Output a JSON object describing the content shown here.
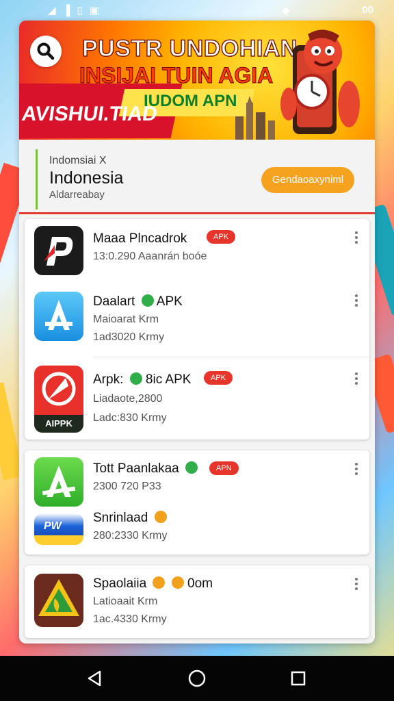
{
  "status_bar": {
    "left_icons": [
      "wifi-icon",
      "signal-icon",
      "battery-icon",
      "notification-icon"
    ],
    "right_text": "00"
  },
  "banner": {
    "title_line1": "PUSTR UNDOHIAN",
    "title_line2": "INSIJAI TUIN AGIA",
    "title_line3": "AVISHUI.TIAD",
    "title_line4": "IUDOM APN"
  },
  "region": {
    "subtitle": "Indomsiai X",
    "name": "Indonesia",
    "meta": "Aldarreabay",
    "button_label": "Gendaoaxyniml"
  },
  "app_groups": [
    {
      "items": [
        {
          "name": "Maaa Plncadrok",
          "lines": [
            "13:0.290 Aaanrán boóe"
          ],
          "badge": "APK",
          "icon": "p-app-icon"
        },
        {
          "name": "Daalart",
          "suffix": "APK",
          "lines": [
            "Maioarat Krm",
            "1ad3020 Krmy"
          ],
          "icon": "app-store-icon"
        },
        {
          "name": "Arpk:",
          "suffix": "8ic APK",
          "badge": "APK",
          "lines": [
            "Liadaote,2800",
            "Ladc:830 Krmy"
          ],
          "icon": "apk-red-icon",
          "icon_label": "AIPPK"
        }
      ]
    },
    {
      "items": [
        {
          "name": "Tott Paanlakaa",
          "badge": "APN",
          "lines": [
            "2300 720 P33"
          ],
          "icon": "green-a-icon"
        },
        {
          "name": "Snrinlaad",
          "lines": [
            "280:2330 Krmy"
          ],
          "icon": "pw-icon",
          "icon_label": "PW"
        }
      ]
    },
    {
      "items": [
        {
          "name": "Spaolaiia",
          "suffix": "0om",
          "lines": [
            "Latioaait Krm",
            "1ac.4330 Krmy"
          ],
          "icon": "triangle-leaf-icon"
        }
      ]
    }
  ],
  "colors": {
    "accent_orange": "#f5a21f",
    "apk_badge_red": "#e8352b",
    "green_accent": "#7cc142"
  },
  "nav_bar": {
    "buttons": [
      "back-icon",
      "home-icon",
      "recents-icon"
    ]
  }
}
